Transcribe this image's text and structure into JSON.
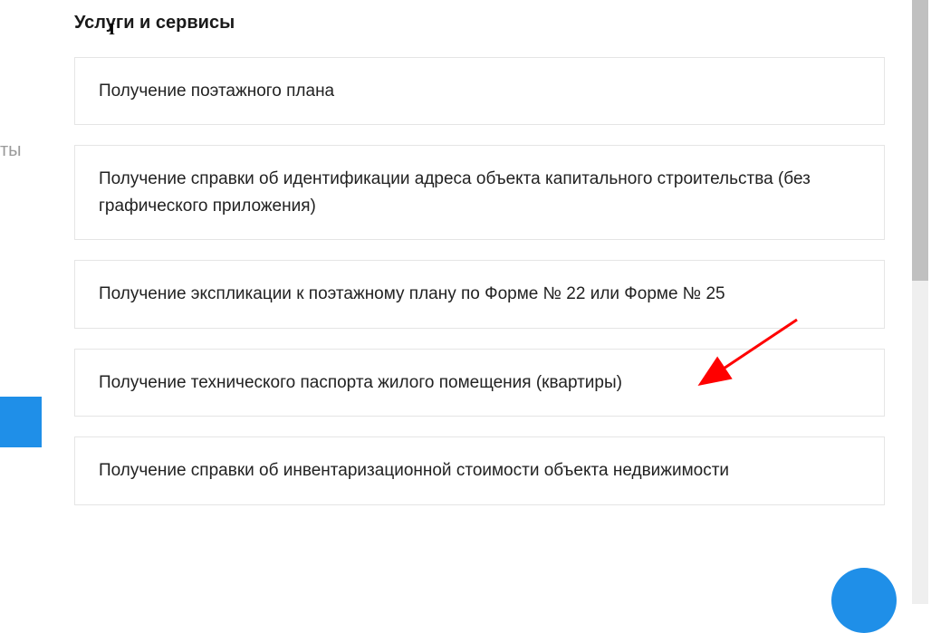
{
  "sidebar": {
    "partial_text": "ты"
  },
  "heading": "Услуги и сервисы",
  "services": [
    {
      "label": "Получение поэтажного плана"
    },
    {
      "label": "Получение справки об идентификации адреса объекта капитального строительства (без графического приложения)"
    },
    {
      "label": "Получение экспликации к поэтажному плану по Форме № 22 или Форме № 25"
    },
    {
      "label": "Получение технического паспорта жилого помещения (квартиры)"
    },
    {
      "label": "Получение справки об инвентаризационной стоимости объекта недвижимости"
    }
  ]
}
